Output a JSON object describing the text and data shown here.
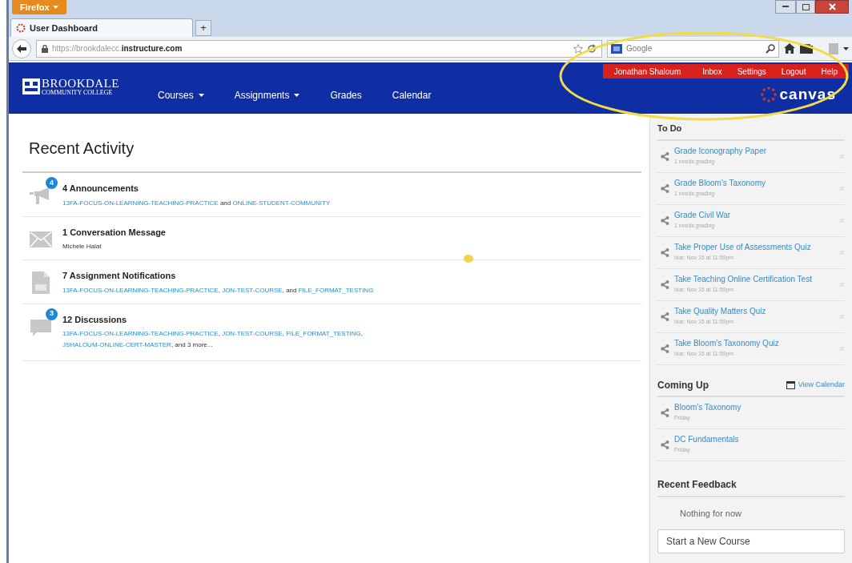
{
  "browser": {
    "menu_button": "Firefox",
    "tab": {
      "title": "User Dashboard",
      "selected": true
    },
    "new_tab": "+",
    "url": {
      "dim": "https://brookdalecc.",
      "host": "instructure.com"
    },
    "search": {
      "placeholder": "Google"
    }
  },
  "header": {
    "logo": {
      "name": "BROOKDALE",
      "sub": "COMMUNITY COLLEGE"
    },
    "nav": [
      {
        "label": "Courses",
        "dropdown": true
      },
      {
        "label": "Assignments",
        "dropdown": true
      },
      {
        "label": "Grades",
        "dropdown": false
      },
      {
        "label": "Calendar",
        "dropdown": false
      }
    ],
    "user_menu": [
      "Jonathan Shaloum",
      "Inbox",
      "Settings",
      "Logout",
      "Help"
    ],
    "brand": "canvas"
  },
  "activity": {
    "title": "Recent Activity",
    "items": [
      {
        "kind": "announcement",
        "badge": "4",
        "title": "4 Announcements",
        "parts": [
          {
            "kind": "link",
            "text": "13FA-FOCUS-ON-LEARNING-TEACHING-PRACTICE"
          },
          {
            "kind": "plain",
            "text": " and "
          },
          {
            "kind": "link",
            "text": "ONLINE-STUDENT-COMMUNITY"
          }
        ]
      },
      {
        "kind": "message",
        "title": "1 Conversation Message",
        "parts": [
          {
            "kind": "plain",
            "text": "Michele Halat"
          }
        ]
      },
      {
        "kind": "assignment",
        "title": "7 Assignment Notifications",
        "parts": [
          {
            "kind": "link",
            "text": "13FA-FOCUS-ON-LEARNING-TEACHING-PRACTICE"
          },
          {
            "kind": "plain",
            "text": ", "
          },
          {
            "kind": "link",
            "text": "JON-TEST-COURSE"
          },
          {
            "kind": "plain",
            "text": ", and "
          },
          {
            "kind": "link",
            "text": "FILE_FORMAT_TESTING"
          }
        ]
      },
      {
        "kind": "discussion",
        "badge": "3",
        "title": "12 Discussions",
        "parts": [
          {
            "kind": "link",
            "text": "13FA-FOCUS-ON-LEARNING-TEACHING-PRACTICE"
          },
          {
            "kind": "plain",
            "text": ", "
          },
          {
            "kind": "link",
            "text": "JON-TEST-COURSE"
          },
          {
            "kind": "plain",
            "text": ", "
          },
          {
            "kind": "link",
            "text": "FILE_FORMAT_TESTING"
          },
          {
            "kind": "plain",
            "text": ", "
          },
          {
            "kind": "link",
            "text": "JSHALOUM-ONLINE-CERT-MASTER"
          },
          {
            "kind": "plain",
            "text": ", and 3 more..."
          }
        ]
      }
    ]
  },
  "sidebar": {
    "todo": {
      "title": "To Do",
      "items": [
        {
          "title": "Grade Iconography Paper",
          "detail": "1 needs grading"
        },
        {
          "title": "Grade Bloom's Taxonomy",
          "detail": "1 needs grading"
        },
        {
          "title": "Grade Civil War",
          "detail": "1 needs grading"
        },
        {
          "title": "Take Proper Use of Assessments Quiz",
          "detail": "due: Nov 15 at 11:59pm"
        },
        {
          "title": "Take Teaching Online Certification Test",
          "detail": "due: Nov 15 at 11:59pm"
        },
        {
          "title": "Take Quality Matters Quiz",
          "detail": "due: Nov 15 at 11:59pm"
        },
        {
          "title": "Take Bloom's Taxonomy Quiz",
          "detail": "due: Nov 15 at 11:59pm"
        }
      ]
    },
    "coming_up": {
      "title": "Coming Up",
      "link": "View Calendar",
      "items": [
        {
          "title": "Bloom's Taxonomy",
          "detail": "Friday"
        },
        {
          "title": "DC Fundamentals",
          "detail": "Friday"
        }
      ]
    },
    "feedback": {
      "title": "Recent Feedback",
      "empty": "Nothing for now"
    },
    "button": "Start a New Course"
  }
}
